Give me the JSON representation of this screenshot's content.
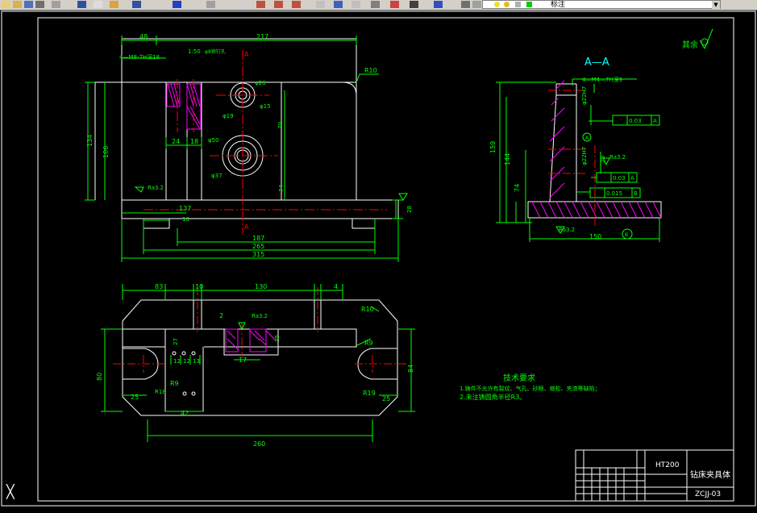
{
  "toolbar": {
    "layer_name": "标注",
    "icons": [
      "new-icon",
      "open-icon",
      "save-icon",
      "print-icon",
      "preview-icon",
      "cut-icon",
      "copy-icon",
      "paste-icon",
      "matchprop-icon",
      "undo-icon",
      "redo-icon",
      "pan-icon",
      "zoom-realtime-icon",
      "zoom-window-icon",
      "zoom-previous-icon",
      "properties-icon",
      "designcenter-icon",
      "toolpalette-icon",
      "sheetset-icon",
      "markup-icon",
      "calculator-icon",
      "help-icon",
      "layer-manager-icon",
      "layer-state-icon"
    ]
  },
  "front_view": {
    "dims": {
      "top_left": "48",
      "top_total": "217",
      "thread": "4—M8-7H深18",
      "taper": "1:50",
      "pin": "φ8销钉孔",
      "r10": "R10",
      "d26": "φ26",
      "d15": "φ15",
      "d19": "φ19",
      "d50": "φ50",
      "d37": "φ37",
      "h70": "70",
      "h74": "74",
      "h134": "134",
      "h106": "106",
      "w24": "24",
      "w18": "18",
      "ra": "Ra3.2",
      "w137": "137",
      "w10": "10",
      "h28": "28",
      "w187": "187",
      "w265": "265",
      "w315": "315",
      "section_a": "A"
    }
  },
  "section_view": {
    "title": "A—A",
    "thread": "4—M4—7H深9",
    "fit1": "φ22H7",
    "fit2": "φ22H7",
    "tol1": "0.03",
    "datum1": "A",
    "tol2": "0.03",
    "datum2": "A",
    "tol3": "0.015",
    "datum3": "B",
    "datum_a": "A",
    "datum_b": "B",
    "h159": "159",
    "h144": "144",
    "h74": "74",
    "h28": "28",
    "w150": "150",
    "ra1": "Ra3.2",
    "ra2": "Ra3.2"
  },
  "top_view": {
    "dims": {
      "w83": "83",
      "w10": "10",
      "w130": "130",
      "w4": "4",
      "w2": "2",
      "ra": "Ra3.2",
      "r10": "R10",
      "w27": "27",
      "w35": "35",
      "w17": "17",
      "w12a": "12",
      "w12b": "12",
      "w13": "13",
      "h80": "80",
      "r9a": "R9",
      "r18": "R18",
      "r9b": "R9",
      "r19": "R19",
      "h84": "84",
      "w25a": "25",
      "w42": "42",
      "w25b": "25",
      "w260": "260"
    }
  },
  "surface_note": "其余",
  "tech_req": {
    "title": "技术要求",
    "line1": "1.铸件不允许有裂纹、气孔、砂眼、缩松、夹渣等缺陷；",
    "line2": "2.未注铸圆角半径R3。"
  },
  "title_block": {
    "material": "HT200",
    "part_name": "钻床夹具体",
    "drawing_no": "ZCJJ-03"
  },
  "colors": {
    "outline": "#ffffff",
    "dimension": "#00ff00",
    "centerline": "#ff0000",
    "hatch": "#ff00ff",
    "text": "#00ffff",
    "blue": "#0000ff",
    "background": "#000000"
  }
}
